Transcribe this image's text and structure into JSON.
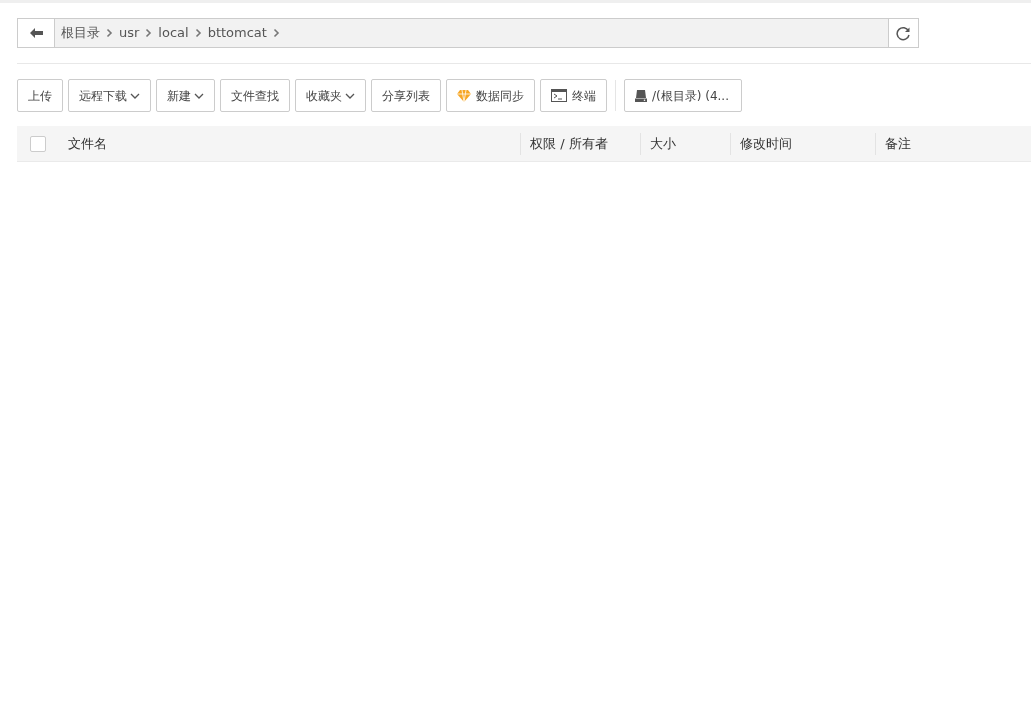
{
  "path_bar": {
    "segments": [
      "根目录",
      "usr",
      "local",
      "bttomcat"
    ]
  },
  "toolbar": {
    "buttons": [
      {
        "label": "上传",
        "kind": "plain"
      },
      {
        "label": "远程下载",
        "kind": "dropdown"
      },
      {
        "label": "新建",
        "kind": "dropdown"
      },
      {
        "label": "文件查找",
        "kind": "plain"
      },
      {
        "label": "收藏夹",
        "kind": "dropdown"
      },
      {
        "label": "分享列表",
        "kind": "plain"
      },
      {
        "label": "数据同步",
        "kind": "diamond"
      },
      {
        "label": "终端",
        "kind": "terminal"
      },
      {
        "label": "/(根目录) (4...",
        "kind": "disk"
      }
    ]
  },
  "table": {
    "select_all": {
      "checked": false
    },
    "columns": [
      "文件名",
      "权限 / 所有者",
      "大小",
      "修改时间",
      "备注"
    ]
  }
}
